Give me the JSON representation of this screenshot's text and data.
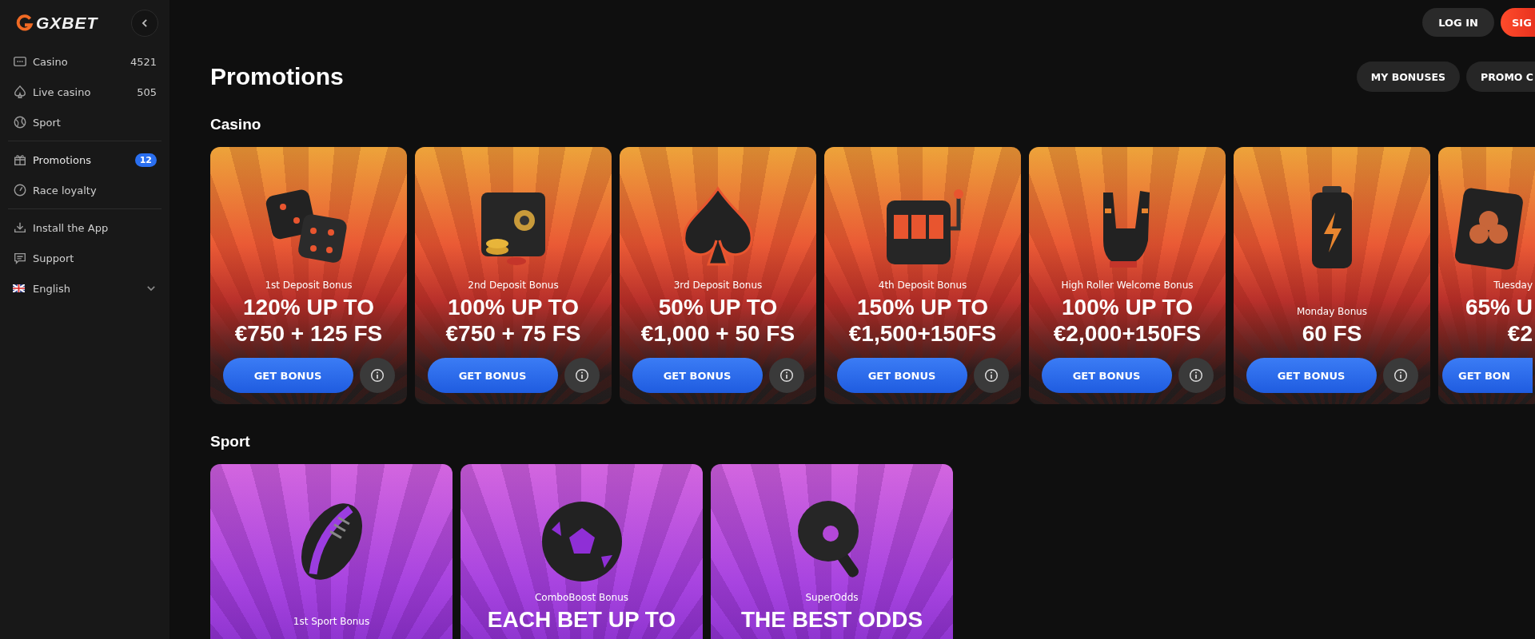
{
  "sidebar": {
    "logo": "GXBET",
    "groups": [
      [
        {
          "label": "Casino",
          "count": "4521",
          "selected": false
        },
        {
          "label": "Live casino",
          "count": "505",
          "selected": false
        },
        {
          "label": "Sport",
          "selected": false
        }
      ],
      [
        {
          "label": "Promotions",
          "badge": "12",
          "selected": true
        },
        {
          "label": "Race loyalty",
          "selected": false
        }
      ],
      [
        {
          "label": "Install the App",
          "selected": false
        },
        {
          "label": "Support",
          "selected": false
        }
      ]
    ],
    "language": "English"
  },
  "header": {
    "buttons": [
      {
        "kind": "plain",
        "label": "LOG IN"
      },
      {
        "kind": "accent",
        "label": "SIG"
      }
    ]
  },
  "page": {
    "title": "Promotions",
    "buttons": [
      {
        "label": "MY BONUSES"
      },
      {
        "label": "PROMO C"
      }
    ]
  },
  "sections": [
    {
      "title": "Casino",
      "kind": "casino",
      "cards": [
        {
          "subtitle": "1st Deposit Bonus",
          "lines": [
            "120% UP TO",
            "€750 + 125 FS"
          ],
          "button": "GET BONUS"
        },
        {
          "subtitle": "2nd Deposit Bonus",
          "lines": [
            "100% UP TO",
            "€750 + 75 FS"
          ],
          "button": "GET BONUS"
        },
        {
          "subtitle": "3rd Deposit Bonus",
          "lines": [
            "50% UP TO",
            "€1,000 + 50 FS"
          ],
          "button": "GET BONUS"
        },
        {
          "subtitle": "4th Deposit Bonus",
          "lines": [
            "150% UP TO",
            "€1,500+150FS"
          ],
          "button": "GET BONUS"
        },
        {
          "subtitle": "High Roller Welcome Bonus",
          "lines": [
            "100% UP TO",
            "€2,000+150FS"
          ],
          "button": "GET BONUS"
        },
        {
          "subtitle": "Monday Bonus",
          "lines": [
            "60 FS"
          ],
          "button": "GET BONUS"
        },
        {
          "subtitle": "Tuesday",
          "lines": [
            "65% U",
            "€2"
          ],
          "button": "GET BON",
          "clipped": true
        }
      ]
    },
    {
      "title": "Sport",
      "kind": "sport",
      "cards": [
        {
          "subtitle": "1st Sport Bonus"
        },
        {
          "subtitle": "ComboBoost Bonus",
          "lines": [
            "EACH BET UP TO"
          ]
        },
        {
          "subtitle": "SuperOdds",
          "lines": [
            "THE BEST ODDS"
          ]
        }
      ]
    }
  ]
}
